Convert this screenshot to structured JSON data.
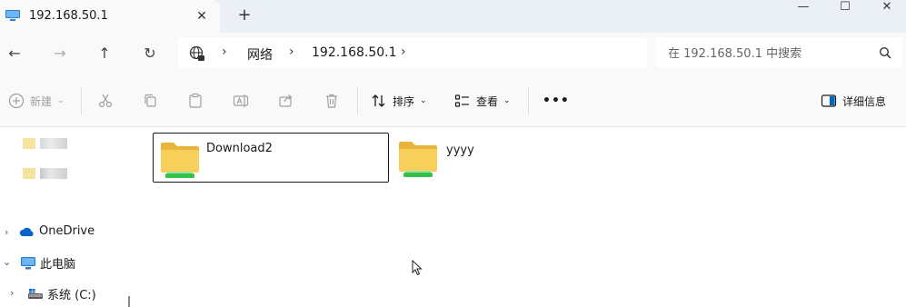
{
  "window": {
    "tab_title": "192.168.50.1",
    "new_tab": "+",
    "controls": {
      "minimize": "—",
      "maximize": "☐",
      "close": "✕"
    }
  },
  "nav": {
    "back": "←",
    "forward": "→",
    "up": "↑",
    "refresh": "↻",
    "breadcrumb": [
      "网络",
      "192.168.50.1"
    ],
    "search_placeholder": "在 192.168.50.1 中搜索"
  },
  "toolbar": {
    "new_label": "新建",
    "sort_label": "排序",
    "view_label": "查看",
    "more": "•••",
    "details_label": "详细信息"
  },
  "sidebar": {
    "items": [
      {
        "label": "OneDrive",
        "icon": "onedrive-cloud-icon",
        "expand": "›"
      },
      {
        "label": "此电脑",
        "icon": "this-pc-icon",
        "expand": "⌄"
      },
      {
        "label": "系统 (C:)",
        "icon": "drive-icon",
        "expand": "›"
      }
    ]
  },
  "content": {
    "folders": [
      {
        "name": "Download2",
        "selected": true
      },
      {
        "name": "yyyy",
        "selected": false
      }
    ]
  },
  "colors": {
    "folder_yellow": "#f5c543",
    "share_green": "#35c24a",
    "accent_blue": "#0067c0"
  }
}
